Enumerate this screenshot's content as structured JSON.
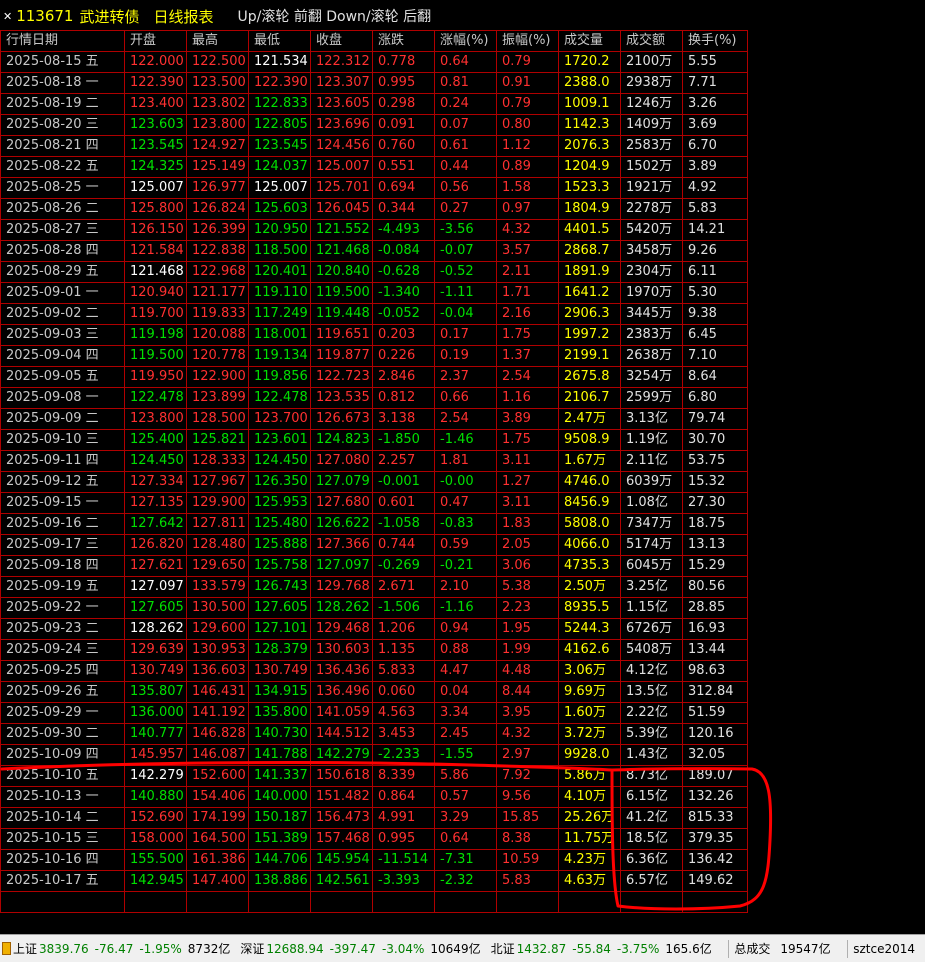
{
  "header": {
    "code": "113671",
    "name": "武进转债",
    "report_title": "日线报表",
    "hint": "Up/滚轮 前翻 Down/滚轮 后翻"
  },
  "columns": [
    "行情日期",
    "开盘",
    "最高",
    "最低",
    "收盘",
    "涨跌",
    "涨幅(%)",
    "振幅(%)",
    "成交量",
    "成交额",
    "换手(%)"
  ],
  "rows": [
    {
      "d": "2025-08-15 五",
      "o": "122.000",
      "h": "122.500",
      "l": "121.534",
      "c": "122.312",
      "chg": "0.778",
      "pct": "0.64",
      "amp": "0.79",
      "vol": "1720.2",
      "amt": "2100万",
      "to": "5.55",
      "oc": "r",
      "hc": "r",
      "lc": "w",
      "cc": "r",
      "sc": "r"
    },
    {
      "d": "2025-08-18 一",
      "o": "122.390",
      "h": "123.500",
      "l": "122.390",
      "c": "123.307",
      "chg": "0.995",
      "pct": "0.81",
      "amp": "0.91",
      "vol": "2388.0",
      "amt": "2938万",
      "to": "7.71",
      "oc": "r",
      "hc": "r",
      "lc": "r",
      "cc": "r",
      "sc": "r"
    },
    {
      "d": "2025-08-19 二",
      "o": "123.400",
      "h": "123.802",
      "l": "122.833",
      "c": "123.605",
      "chg": "0.298",
      "pct": "0.24",
      "amp": "0.79",
      "vol": "1009.1",
      "amt": "1246万",
      "to": "3.26",
      "oc": "r",
      "hc": "r",
      "lc": "g",
      "cc": "r",
      "sc": "r"
    },
    {
      "d": "2025-08-20 三",
      "o": "123.603",
      "h": "123.800",
      "l": "122.805",
      "c": "123.696",
      "chg": "0.091",
      "pct": "0.07",
      "amp": "0.80",
      "vol": "1142.3",
      "amt": "1409万",
      "to": "3.69",
      "oc": "g",
      "hc": "r",
      "lc": "g",
      "cc": "r",
      "sc": "r"
    },
    {
      "d": "2025-08-21 四",
      "o": "123.545",
      "h": "124.927",
      "l": "123.545",
      "c": "124.456",
      "chg": "0.760",
      "pct": "0.61",
      "amp": "1.12",
      "vol": "2076.3",
      "amt": "2583万",
      "to": "6.70",
      "oc": "g",
      "hc": "r",
      "lc": "g",
      "cc": "r",
      "sc": "r"
    },
    {
      "d": "2025-08-22 五",
      "o": "124.325",
      "h": "125.149",
      "l": "124.037",
      "c": "125.007",
      "chg": "0.551",
      "pct": "0.44",
      "amp": "0.89",
      "vol": "1204.9",
      "amt": "1502万",
      "to": "3.89",
      "oc": "g",
      "hc": "r",
      "lc": "g",
      "cc": "r",
      "sc": "r"
    },
    {
      "d": "2025-08-25 一",
      "o": "125.007",
      "h": "126.977",
      "l": "125.007",
      "c": "125.701",
      "chg": "0.694",
      "pct": "0.56",
      "amp": "1.58",
      "vol": "1523.3",
      "amt": "1921万",
      "to": "4.92",
      "oc": "w",
      "hc": "r",
      "lc": "w",
      "cc": "r",
      "sc": "r"
    },
    {
      "d": "2025-08-26 二",
      "o": "125.800",
      "h": "126.824",
      "l": "125.603",
      "c": "126.045",
      "chg": "0.344",
      "pct": "0.27",
      "amp": "0.97",
      "vol": "1804.9",
      "amt": "2278万",
      "to": "5.83",
      "oc": "r",
      "hc": "r",
      "lc": "g",
      "cc": "r",
      "sc": "r"
    },
    {
      "d": "2025-08-27 三",
      "o": "126.150",
      "h": "126.399",
      "l": "120.950",
      "c": "121.552",
      "chg": "-4.493",
      "pct": "-3.56",
      "amp": "4.32",
      "vol": "4401.5",
      "amt": "5420万",
      "to": "14.21",
      "oc": "r",
      "hc": "r",
      "lc": "g",
      "cc": "g",
      "sc": "g"
    },
    {
      "d": "2025-08-28 四",
      "o": "121.584",
      "h": "122.838",
      "l": "118.500",
      "c": "121.468",
      "chg": "-0.084",
      "pct": "-0.07",
      "amp": "3.57",
      "vol": "2868.7",
      "amt": "3458万",
      "to": "9.26",
      "oc": "r",
      "hc": "r",
      "lc": "g",
      "cc": "g",
      "sc": "g"
    },
    {
      "d": "2025-08-29 五",
      "o": "121.468",
      "h": "122.968",
      "l": "120.401",
      "c": "120.840",
      "chg": "-0.628",
      "pct": "-0.52",
      "amp": "2.11",
      "vol": "1891.9",
      "amt": "2304万",
      "to": "6.11",
      "oc": "w",
      "hc": "r",
      "lc": "g",
      "cc": "g",
      "sc": "g"
    },
    {
      "d": "2025-09-01 一",
      "o": "120.940",
      "h": "121.177",
      "l": "119.110",
      "c": "119.500",
      "chg": "-1.340",
      "pct": "-1.11",
      "amp": "1.71",
      "vol": "1641.2",
      "amt": "1970万",
      "to": "5.30",
      "oc": "r",
      "hc": "r",
      "lc": "g",
      "cc": "g",
      "sc": "g"
    },
    {
      "d": "2025-09-02 二",
      "o": "119.700",
      "h": "119.833",
      "l": "117.249",
      "c": "119.448",
      "chg": "-0.052",
      "pct": "-0.04",
      "amp": "2.16",
      "vol": "2906.3",
      "amt": "3445万",
      "to": "9.38",
      "oc": "r",
      "hc": "r",
      "lc": "g",
      "cc": "g",
      "sc": "g"
    },
    {
      "d": "2025-09-03 三",
      "o": "119.198",
      "h": "120.088",
      "l": "118.001",
      "c": "119.651",
      "chg": "0.203",
      "pct": "0.17",
      "amp": "1.75",
      "vol": "1997.2",
      "amt": "2383万",
      "to": "6.45",
      "oc": "g",
      "hc": "r",
      "lc": "g",
      "cc": "r",
      "sc": "r"
    },
    {
      "d": "2025-09-04 四",
      "o": "119.500",
      "h": "120.778",
      "l": "119.134",
      "c": "119.877",
      "chg": "0.226",
      "pct": "0.19",
      "amp": "1.37",
      "vol": "2199.1",
      "amt": "2638万",
      "to": "7.10",
      "oc": "g",
      "hc": "r",
      "lc": "g",
      "cc": "r",
      "sc": "r"
    },
    {
      "d": "2025-09-05 五",
      "o": "119.950",
      "h": "122.900",
      "l": "119.856",
      "c": "122.723",
      "chg": "2.846",
      "pct": "2.37",
      "amp": "2.54",
      "vol": "2675.8",
      "amt": "3254万",
      "to": "8.64",
      "oc": "r",
      "hc": "r",
      "lc": "g",
      "cc": "r",
      "sc": "r"
    },
    {
      "d": "2025-09-08 一",
      "o": "122.478",
      "h": "123.899",
      "l": "122.478",
      "c": "123.535",
      "chg": "0.812",
      "pct": "0.66",
      "amp": "1.16",
      "vol": "2106.7",
      "amt": "2599万",
      "to": "6.80",
      "oc": "g",
      "hc": "r",
      "lc": "g",
      "cc": "r",
      "sc": "r"
    },
    {
      "d": "2025-09-09 二",
      "o": "123.800",
      "h": "128.500",
      "l": "123.700",
      "c": "126.673",
      "chg": "3.138",
      "pct": "2.54",
      "amp": "3.89",
      "vol": "2.47万",
      "amt": "3.13亿",
      "to": "79.74",
      "oc": "r",
      "hc": "r",
      "lc": "r",
      "cc": "r",
      "sc": "r"
    },
    {
      "d": "2025-09-10 三",
      "o": "125.400",
      "h": "125.821",
      "l": "123.601",
      "c": "124.823",
      "chg": "-1.850",
      "pct": "-1.46",
      "amp": "1.75",
      "vol": "9508.9",
      "amt": "1.19亿",
      "to": "30.70",
      "oc": "g",
      "hc": "g",
      "lc": "g",
      "cc": "g",
      "sc": "g"
    },
    {
      "d": "2025-09-11 四",
      "o": "124.450",
      "h": "128.333",
      "l": "124.450",
      "c": "127.080",
      "chg": "2.257",
      "pct": "1.81",
      "amp": "3.11",
      "vol": "1.67万",
      "amt": "2.11亿",
      "to": "53.75",
      "oc": "g",
      "hc": "r",
      "lc": "g",
      "cc": "r",
      "sc": "r"
    },
    {
      "d": "2025-09-12 五",
      "o": "127.334",
      "h": "127.967",
      "l": "126.350",
      "c": "127.079",
      "chg": "-0.001",
      "pct": "-0.00",
      "amp": "1.27",
      "vol": "4746.0",
      "amt": "6039万",
      "to": "15.32",
      "oc": "r",
      "hc": "r",
      "lc": "g",
      "cc": "g",
      "sc": "g"
    },
    {
      "d": "2025-09-15 一",
      "o": "127.135",
      "h": "129.900",
      "l": "125.953",
      "c": "127.680",
      "chg": "0.601",
      "pct": "0.47",
      "amp": "3.11",
      "vol": "8456.9",
      "amt": "1.08亿",
      "to": "27.30",
      "oc": "r",
      "hc": "r",
      "lc": "g",
      "cc": "r",
      "sc": "r"
    },
    {
      "d": "2025-09-16 二",
      "o": "127.642",
      "h": "127.811",
      "l": "125.480",
      "c": "126.622",
      "chg": "-1.058",
      "pct": "-0.83",
      "amp": "1.83",
      "vol": "5808.0",
      "amt": "7347万",
      "to": "18.75",
      "oc": "g",
      "hc": "r",
      "lc": "g",
      "cc": "g",
      "sc": "g"
    },
    {
      "d": "2025-09-17 三",
      "o": "126.820",
      "h": "128.480",
      "l": "125.888",
      "c": "127.366",
      "chg": "0.744",
      "pct": "0.59",
      "amp": "2.05",
      "vol": "4066.0",
      "amt": "5174万",
      "to": "13.13",
      "oc": "r",
      "hc": "r",
      "lc": "g",
      "cc": "r",
      "sc": "r"
    },
    {
      "d": "2025-09-18 四",
      "o": "127.621",
      "h": "129.650",
      "l": "125.758",
      "c": "127.097",
      "chg": "-0.269",
      "pct": "-0.21",
      "amp": "3.06",
      "vol": "4735.3",
      "amt": "6045万",
      "to": "15.29",
      "oc": "r",
      "hc": "r",
      "lc": "g",
      "cc": "g",
      "sc": "g"
    },
    {
      "d": "2025-09-19 五",
      "o": "127.097",
      "h": "133.579",
      "l": "126.743",
      "c": "129.768",
      "chg": "2.671",
      "pct": "2.10",
      "amp": "5.38",
      "vol": "2.50万",
      "amt": "3.25亿",
      "to": "80.56",
      "oc": "w",
      "hc": "r",
      "lc": "g",
      "cc": "r",
      "sc": "r"
    },
    {
      "d": "2025-09-22 一",
      "o": "127.605",
      "h": "130.500",
      "l": "127.605",
      "c": "128.262",
      "chg": "-1.506",
      "pct": "-1.16",
      "amp": "2.23",
      "vol": "8935.5",
      "amt": "1.15亿",
      "to": "28.85",
      "oc": "g",
      "hc": "r",
      "lc": "g",
      "cc": "g",
      "sc": "g"
    },
    {
      "d": "2025-09-23 二",
      "o": "128.262",
      "h": "129.600",
      "l": "127.101",
      "c": "129.468",
      "chg": "1.206",
      "pct": "0.94",
      "amp": "1.95",
      "vol": "5244.3",
      "amt": "6726万",
      "to": "16.93",
      "oc": "w",
      "hc": "r",
      "lc": "g",
      "cc": "r",
      "sc": "r"
    },
    {
      "d": "2025-09-24 三",
      "o": "129.639",
      "h": "130.953",
      "l": "128.379",
      "c": "130.603",
      "chg": "1.135",
      "pct": "0.88",
      "amp": "1.99",
      "vol": "4162.6",
      "amt": "5408万",
      "to": "13.44",
      "oc": "r",
      "hc": "r",
      "lc": "g",
      "cc": "r",
      "sc": "r"
    },
    {
      "d": "2025-09-25 四",
      "o": "130.749",
      "h": "136.603",
      "l": "130.749",
      "c": "136.436",
      "chg": "5.833",
      "pct": "4.47",
      "amp": "4.48",
      "vol": "3.06万",
      "amt": "4.12亿",
      "to": "98.63",
      "oc": "r",
      "hc": "r",
      "lc": "r",
      "cc": "r",
      "sc": "r"
    },
    {
      "d": "2025-09-26 五",
      "o": "135.807",
      "h": "146.431",
      "l": "134.915",
      "c": "136.496",
      "chg": "0.060",
      "pct": "0.04",
      "amp": "8.44",
      "vol": "9.69万",
      "amt": "13.5亿",
      "to": "312.84",
      "oc": "g",
      "hc": "r",
      "lc": "g",
      "cc": "r",
      "sc": "r"
    },
    {
      "d": "2025-09-29 一",
      "o": "136.000",
      "h": "141.192",
      "l": "135.800",
      "c": "141.059",
      "chg": "4.563",
      "pct": "3.34",
      "amp": "3.95",
      "vol": "1.60万",
      "amt": "2.22亿",
      "to": "51.59",
      "oc": "g",
      "hc": "r",
      "lc": "g",
      "cc": "r",
      "sc": "r"
    },
    {
      "d": "2025-09-30 二",
      "o": "140.777",
      "h": "146.828",
      "l": "140.730",
      "c": "144.512",
      "chg": "3.453",
      "pct": "2.45",
      "amp": "4.32",
      "vol": "3.72万",
      "amt": "5.39亿",
      "to": "120.16",
      "oc": "g",
      "hc": "r",
      "lc": "g",
      "cc": "r",
      "sc": "r"
    },
    {
      "d": "2025-10-09 四",
      "o": "145.957",
      "h": "146.087",
      "l": "141.788",
      "c": "142.279",
      "chg": "-2.233",
      "pct": "-1.55",
      "amp": "2.97",
      "vol": "9928.0",
      "amt": "1.43亿",
      "to": "32.05",
      "oc": "r",
      "hc": "r",
      "lc": "g",
      "cc": "g",
      "sc": "g"
    },
    {
      "d": "2025-10-10 五",
      "o": "142.279",
      "h": "152.600",
      "l": "141.337",
      "c": "150.618",
      "chg": "8.339",
      "pct": "5.86",
      "amp": "7.92",
      "vol": "5.86万",
      "amt": "8.73亿",
      "to": "189.07",
      "oc": "w",
      "hc": "r",
      "lc": "g",
      "cc": "r",
      "sc": "r"
    },
    {
      "d": "2025-10-13 一",
      "o": "140.880",
      "h": "154.406",
      "l": "140.000",
      "c": "151.482",
      "chg": "0.864",
      "pct": "0.57",
      "amp": "9.56",
      "vol": "4.10万",
      "amt": "6.15亿",
      "to": "132.26",
      "oc": "g",
      "hc": "r",
      "lc": "g",
      "cc": "r",
      "sc": "r"
    },
    {
      "d": "2025-10-14 二",
      "o": "152.690",
      "h": "174.199",
      "l": "150.187",
      "c": "156.473",
      "chg": "4.991",
      "pct": "3.29",
      "amp": "15.85",
      "vol": "25.26万",
      "amt": "41.2亿",
      "to": "815.33",
      "oc": "r",
      "hc": "r",
      "lc": "g",
      "cc": "r",
      "sc": "r"
    },
    {
      "d": "2025-10-15 三",
      "o": "158.000",
      "h": "164.500",
      "l": "151.389",
      "c": "157.468",
      "chg": "0.995",
      "pct": "0.64",
      "amp": "8.38",
      "vol": "11.75万",
      "amt": "18.5亿",
      "to": "379.35",
      "oc": "r",
      "hc": "r",
      "lc": "g",
      "cc": "r",
      "sc": "r"
    },
    {
      "d": "2025-10-16 四",
      "o": "155.500",
      "h": "161.386",
      "l": "144.706",
      "c": "145.954",
      "chg": "-11.514",
      "pct": "-7.31",
      "amp": "10.59",
      "vol": "4.23万",
      "amt": "6.36亿",
      "to": "136.42",
      "oc": "g",
      "hc": "r",
      "lc": "g",
      "cc": "g",
      "sc": "g"
    },
    {
      "d": "2025-10-17 五",
      "o": "142.945",
      "h": "147.400",
      "l": "138.886",
      "c": "142.561",
      "chg": "-3.393",
      "pct": "-2.32",
      "amp": "5.83",
      "vol": "4.63万",
      "amt": "6.57亿",
      "to": "149.62",
      "oc": "g",
      "hc": "r",
      "lc": "g",
      "cc": "g",
      "sc": "g"
    }
  ],
  "statusbar": {
    "sh_label": "上证",
    "sh_val": "3839.76",
    "sh_chg": "-76.47",
    "sh_pct": "-1.95%",
    "sh_amt": "8732亿",
    "sz_label": "深证",
    "sz_val": "12688.94",
    "sz_chg": "-397.47",
    "sz_pct": "-3.04%",
    "sz_amt": "10649亿",
    "bz_label": "北证",
    "bz_val": "1432.87",
    "bz_chg": "-55.84",
    "bz_pct": "-3.75%",
    "bz_amt": "165.6亿",
    "total_label": "总成交",
    "total_val": "19547亿",
    "site": "sztce2014"
  },
  "colors": {
    "up": "#ff3030",
    "down": "#00e000",
    "flat": "#ffffff",
    "grid": "#b00000",
    "annotation": "#ff0000"
  }
}
